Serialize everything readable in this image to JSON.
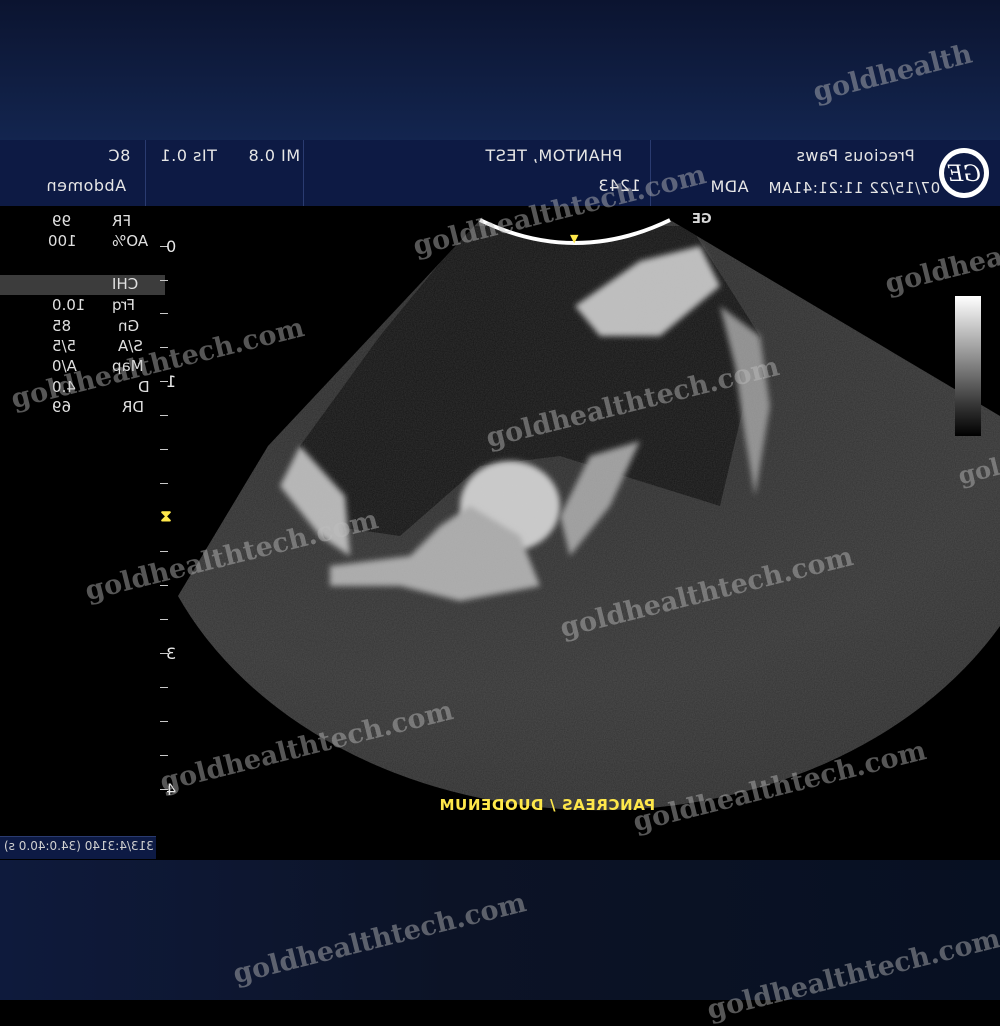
{
  "header": {
    "probe": "8C",
    "preset": "Abdomen",
    "tis": "TIs 0.1",
    "mi": "MI 0.8",
    "patient_name": "PHANTOM, TEST",
    "patient_id": "1243",
    "institution": "Precious Paws",
    "datetime": "07/15/22 11:21:41AM",
    "operator": "ADM"
  },
  "params": [
    {
      "label": "FR",
      "value": "99"
    },
    {
      "label": "AO%",
      "value": "100"
    },
    {
      "label": "CHI",
      "value": ""
    },
    {
      "label": "Frq",
      "value": "10.0"
    },
    {
      "label": "Gn",
      "value": "85"
    },
    {
      "label": "S/A",
      "value": "5/5"
    },
    {
      "label": "Map",
      "value": "A/0"
    },
    {
      "label": "D",
      "value": "4.0"
    },
    {
      "label": "DR",
      "value": "69"
    }
  ],
  "depth_scale": [
    "0",
    "1",
    "3",
    "4"
  ],
  "annotation": "PANCREAS / DUODENUM",
  "cine": "313/4:3140 (34.0:40.0 s)",
  "brand": {
    "logo_text": "GE",
    "small_mark": "GE"
  },
  "watermark": "goldhealthtech.com",
  "watermark_short": "goldhealth",
  "colors": {
    "accent_yellow": "#ffe84a",
    "header_blue": "#0d1a44"
  }
}
